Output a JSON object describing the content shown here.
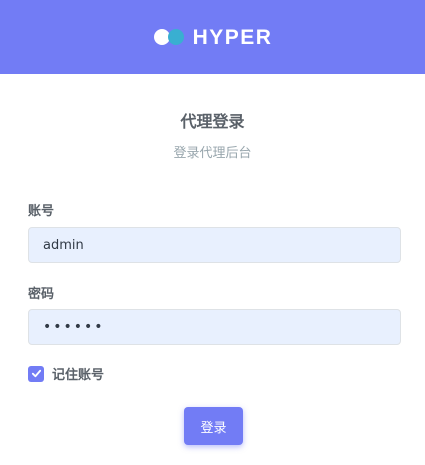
{
  "header": {
    "brand_text": "HYPER",
    "logo_icon": "hyper-logo-icon",
    "background_color": "#727cf5"
  },
  "main": {
    "title": "代理登录",
    "subtitle": "登录代理后台"
  },
  "form": {
    "account_label": "账号",
    "account_value": "admin",
    "password_label": "密码",
    "password_value": "••••••",
    "remember_label": "记住账号",
    "remember_checked": true,
    "check_icon": "checkmark-icon",
    "login_button_label": "登录",
    "accent_color": "#727cf5"
  }
}
